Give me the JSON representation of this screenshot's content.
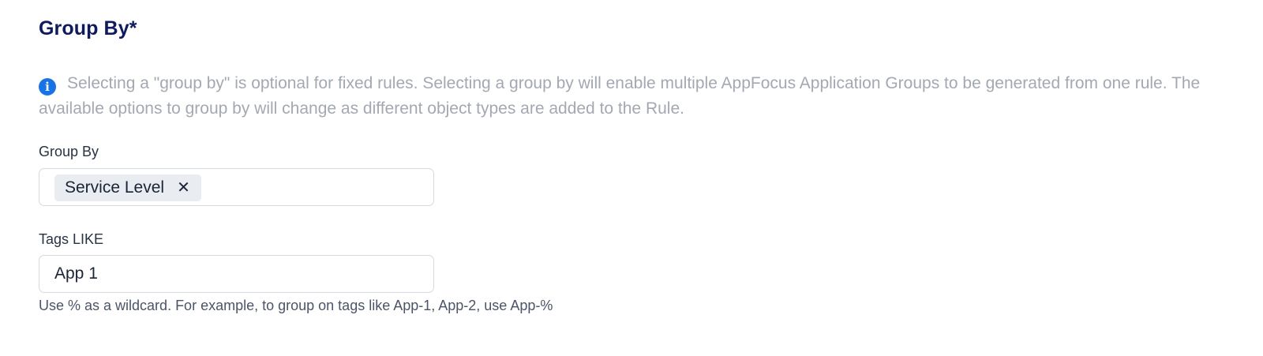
{
  "section": {
    "title": "Group By*",
    "info_icon": "info-circle-icon",
    "info_text": "Selecting a \"group by\" is optional for fixed rules. Selecting a group by will enable multiple AppFocus Application Groups to be generated from one rule. The available options to group by will change as different object types are added to the Rule."
  },
  "group_by_field": {
    "label": "Group By",
    "selected": [
      {
        "label": "Service Level",
        "remove_icon": "close-icon",
        "remove_glyph": "✕"
      }
    ]
  },
  "tags_field": {
    "label": "Tags LIKE",
    "value": "App 1",
    "help": "Use % as a wildcard. For example, to group on tags like App-1, App-2, use App-%"
  },
  "colors": {
    "title": "#0f1b5a",
    "info_icon": "#1773e6",
    "muted_text": "#a3a8b2",
    "chip_bg": "#e9ecf0",
    "input_border": "#d6d9de"
  }
}
